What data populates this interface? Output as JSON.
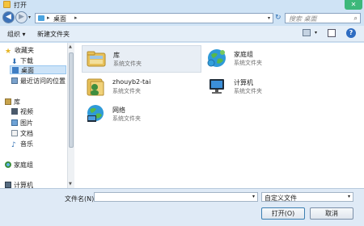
{
  "window": {
    "title": "打开",
    "close_glyph": "✕"
  },
  "nav": {
    "back_glyph": "◀",
    "forward_glyph": "▶",
    "dropdown_glyph": "▾"
  },
  "address": {
    "separator": "▸",
    "location": "桌面",
    "dropdown_glyph": "▾",
    "refresh_glyph": "↻"
  },
  "search": {
    "placeholder": "搜索 桌面",
    "icon_glyph": "⌕"
  },
  "toolbar": {
    "organize_label": "组织 ▾",
    "new_folder_label": "新建文件夹",
    "view_dropdown_glyph": "▾",
    "help_glyph": "?"
  },
  "sidebar": {
    "groups": [
      {
        "label": "收藏夹",
        "items": [
          "下载",
          "桌面",
          "最近访问的位置"
        ]
      },
      {
        "label": "库",
        "items": [
          "视频",
          "图片",
          "文档",
          "音乐"
        ]
      },
      {
        "label": "家庭组",
        "items": []
      },
      {
        "label": "计算机",
        "items": []
      }
    ],
    "selected": "桌面"
  },
  "items": [
    {
      "name": "库",
      "type": "系统文件夹",
      "icon": "library-icon"
    },
    {
      "name": "家庭组",
      "type": "系统文件夹",
      "icon": "homegroup-icon"
    },
    {
      "name": "zhouyb2-tai",
      "type": "系统文件夹",
      "icon": "user-folder-icon"
    },
    {
      "name": "计算机",
      "type": "系统文件夹",
      "icon": "computer-icon"
    },
    {
      "name": "网络",
      "type": "系统文件夹",
      "icon": "network-icon"
    }
  ],
  "footer": {
    "filename_label": "文件名(N):",
    "filename_value": "",
    "filetype_value": "自定义文件",
    "open_label": "打开(O)",
    "cancel_label": "取消"
  },
  "colors": {
    "accent": "#3c72b8",
    "selection": "#cce3f8",
    "close": "#3db87a"
  }
}
